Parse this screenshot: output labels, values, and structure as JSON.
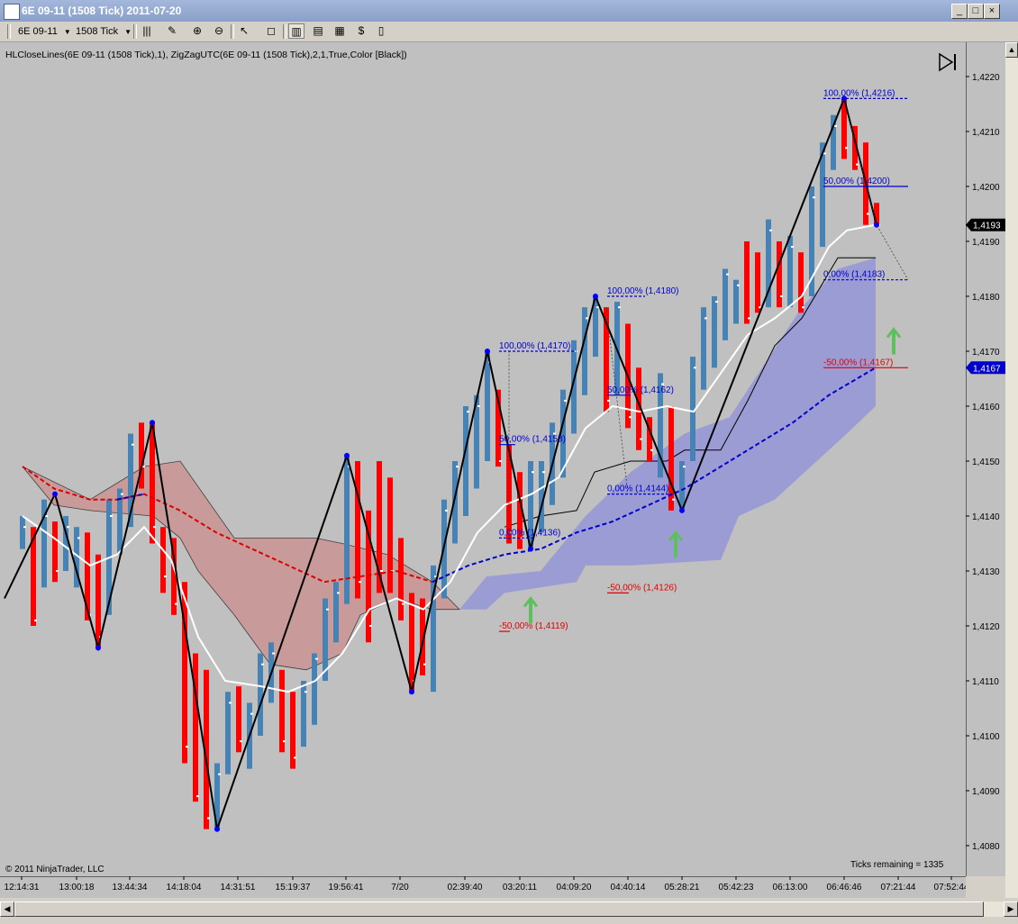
{
  "window": {
    "title": "6E 09-11 (1508 Tick)  2011-07-20",
    "minimize_label": "_",
    "maximize_label": "□",
    "close_label": "×"
  },
  "toolbar": {
    "instrument": "6E 09-11",
    "interval": "1508 Tick"
  },
  "indicator_label": "HLCloseLines(6E 09-11 (1508 Tick),1), ZigZagUTC(6E 09-11 (1508 Tick),2,1,True,Color [Black])",
  "copyright": "© 2011 NinjaTrader, LLC",
  "ticks_remaining": "Ticks remaining = 1335",
  "colors": {
    "background": "#c0c0c0",
    "up_bar": "#4682b4",
    "down_bar": "#ff0000",
    "cloud_red": "#c89a9a",
    "cloud_blue": "#9c9cd4",
    "fib_blue": "#0000cd",
    "fib_red": "#e00000"
  },
  "chart_data": {
    "type": "candlestick",
    "price_axis_labels": [
      "1,4220",
      "1,4210",
      "1,4200",
      "1,4190",
      "1,4180",
      "1,4170",
      "1,4160",
      "1,4150",
      "1,4140",
      "1,4130",
      "1,4120",
      "1,4110",
      "1,4100",
      "1,4090",
      "1,4080"
    ],
    "ylim": [
      1.4075,
      1.4225
    ],
    "time_axis_labels": [
      "12:14:31",
      "13:00:18",
      "13:44:34",
      "14:18:04",
      "14:31:51",
      "15:19:37",
      "19:56:41",
      "7/20",
      "02:39:40",
      "03:20:11",
      "04:09:20",
      "04:40:14",
      "05:28:21",
      "05:42:23",
      "06:13:00",
      "06:46:46",
      "07:21:44",
      "07:52:44"
    ],
    "current_price": "1,4193",
    "current_price_value": 1.4193,
    "moving_average_label": "1,4167",
    "moving_average_value": 1.4167,
    "fib_levels": [
      {
        "text": "100,00% (1,4216)",
        "value": 1.4216,
        "color": "blue"
      },
      {
        "text": "50,00% (1,4200)",
        "value": 1.42,
        "color": "blue"
      },
      {
        "text": "0,00% (1,4183)",
        "value": 1.4183,
        "color": "blue"
      },
      {
        "text": "-50,00% (1,4167)",
        "value": 1.4167,
        "color": "red"
      },
      {
        "text": "100,00% (1,4180)",
        "value": 1.418,
        "color": "blue"
      },
      {
        "text": "50,00% (1,4162)",
        "value": 1.4162,
        "color": "blue"
      },
      {
        "text": "0,00% (1,4144)",
        "value": 1.4144,
        "color": "blue"
      },
      {
        "text": "-50,00% (1,4126)",
        "value": 1.4126,
        "color": "red"
      },
      {
        "text": "100,00% (1,4170)",
        "value": 1.417,
        "color": "blue"
      },
      {
        "text": "50,00% (1,4153)",
        "value": 1.4153,
        "color": "blue"
      },
      {
        "text": "0,00% (1,4136)",
        "value": 1.4136,
        "color": "blue"
      },
      {
        "text": "-50,00% (1,4119)",
        "value": 1.4119,
        "color": "red"
      }
    ],
    "zigzag_prices": [
      1.4125,
      1.4144,
      1.4116,
      1.4157,
      1.4083,
      1.4151,
      1.4108,
      1.417,
      1.4134,
      1.418,
      1.4141,
      1.4216,
      1.4193
    ]
  }
}
